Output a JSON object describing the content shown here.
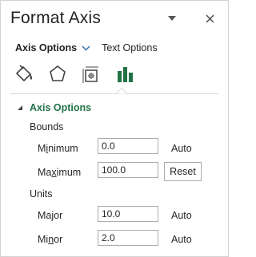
{
  "pane": {
    "title": "Format Axis",
    "accent_color": "#217346"
  },
  "tabs": {
    "active_label": "Axis Options",
    "inactive_label": "Text Options"
  },
  "icon_tabs": [
    "paint-bucket-icon",
    "pentagon-effects-icon",
    "size-properties-icon",
    "bar-chart-icon"
  ],
  "section": {
    "title": "Axis Options"
  },
  "bounds": {
    "group_label": "Bounds",
    "minimum": {
      "label_pre": "M",
      "label_ul": "i",
      "label_post": "nimum",
      "value": "0.0",
      "state": "Auto"
    },
    "maximum": {
      "label_pre": "Ma",
      "label_ul": "x",
      "label_post": "imum",
      "value": "100.0",
      "button": "Reset"
    }
  },
  "units": {
    "group_label": "Units",
    "major": {
      "label_pre": "Ma",
      "label_ul": "j",
      "label_post": "or",
      "value": "10.0",
      "state": "Auto"
    },
    "minor": {
      "label_pre": "Mi",
      "label_ul": "n",
      "label_post": "or",
      "value": "2.0",
      "state": "Auto"
    }
  }
}
